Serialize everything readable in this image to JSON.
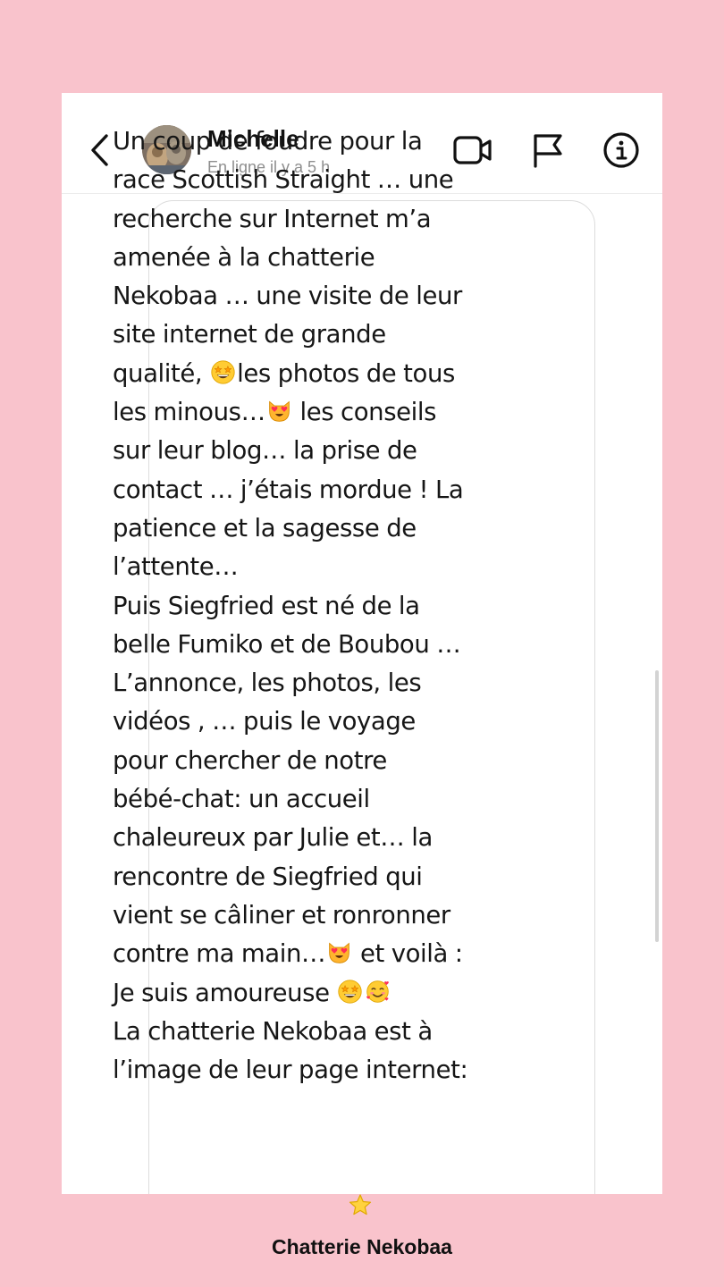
{
  "header": {
    "contact_name": "Michelle",
    "status": "En ligne il y a 5 h",
    "icons": [
      "back-chevron-icon",
      "avatar-photo",
      "video-camera-icon",
      "flag-icon",
      "info-icon"
    ]
  },
  "message": {
    "lines": [
      [
        "Un coup de foudre pour la"
      ],
      [
        "race Scottish Straight … une"
      ],
      [
        "recherche sur Internet m’a"
      ],
      [
        "amenée à la chatterie"
      ],
      [
        "Nekobaa … une visite de leur"
      ],
      [
        "site internet de grande"
      ],
      [
        "qualité, ",
        {
          "emoji": "star-struck-emoji"
        },
        "les photos de tous"
      ],
      [
        "les minous…",
        {
          "emoji": "heart-eyes-cat-emoji"
        },
        " les conseils"
      ],
      [
        "sur leur blog… la prise de"
      ],
      [
        "contact … j’étais mordue ! La"
      ],
      [
        "patience et la sagesse de"
      ],
      [
        "l’attente…"
      ],
      [
        "Puis Siegfried est né de la"
      ],
      [
        "belle Fumiko et de Boubou …"
      ],
      [
        "L’annonce, les photos, les"
      ],
      [
        "vidéos , … puis le voyage"
      ],
      [
        "pour chercher de notre"
      ],
      [
        "bébé-chat: un accueil"
      ],
      [
        "chaleureux par Julie et… la"
      ],
      [
        "rencontre de Siegfried qui"
      ],
      [
        "vient se câliner et ronronner"
      ],
      [
        "contre ma main…",
        {
          "emoji": "heart-eyes-cat-emoji"
        },
        " et voilà :"
      ],
      [
        "Je suis amoureuse ",
        {
          "emoji": "star-struck-emoji"
        },
        {
          "emoji": "smiling-face-with-hearts-emoji"
        }
      ],
      [
        "La chatterie Nekobaa est à"
      ],
      [
        "l’image de leur page internet:"
      ]
    ]
  },
  "footer": {
    "label": "Chatterie Nekobaa",
    "icon": "star-emoji"
  },
  "colors": {
    "background": "#f9c3cc",
    "card": "#ffffff",
    "bubble_border": "#dcdcdc",
    "status_text": "#8e8e8e"
  }
}
